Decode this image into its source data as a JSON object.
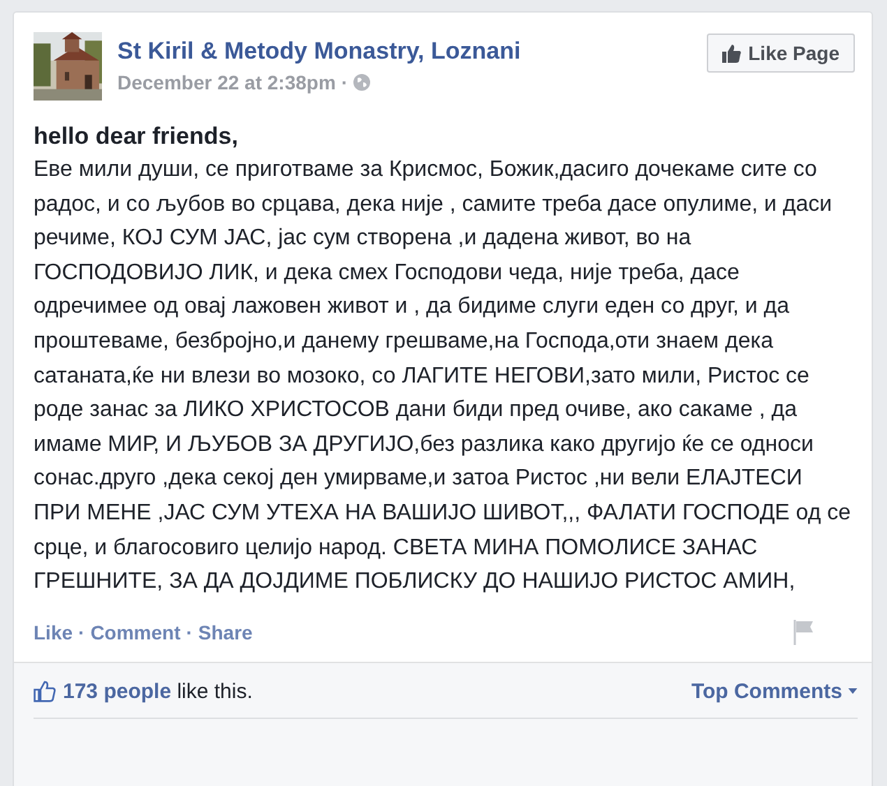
{
  "post": {
    "page_name": "St Kiril & Metody Monastry, Loznani",
    "date": "December 22 at 2:38pm",
    "date_separator": "·",
    "like_page_button": "Like Page",
    "greeting": "hello dear friends,",
    "body": "Еве мили души, се приготваме за Крисмос, Божик,дасиго дочекаме сите со радос, и со љубов во срцава, дека није , самите треба дасе опулиме, и даси речиме, КОЈ СУМ ЈАС, јас сум створена ,и дадена живот, во на ГОСПОДОВИЈО ЛИК, и дека смех Господови чеда, није треба, дасе одречимее од овај лажовен живот и , да бидиме слуги еден со друг, и да проштеваме, безбројно,и данему грешваме,на Господа,оти знаем дека сатаната,ќе ни влези во мозоко, со ЛАГИТЕ НЕГОВИ,зато мили, Ристос се роде занас за ЛИКО ХРИСТОСОВ дани биди пред очиве, ако сакаме , да имаме МИР, И ЉУБОВ ЗА ДРУГИЈО,без разлика како другијо ќе се односи сонас.друго ,дека секој ден умирваме,и затоа Ристос ,ни вели ЕЛАЈТЕСИ ПРИ МЕНЕ ,ЈАС СУМ УТЕХА НА ВАШИЈО ШИВОТ,,, ФАЛАТИ ГОСПОДЕ од се срце, и благосовиго целијо народ. СВЕТА МИНА ПОМОЛИСЕ ЗАНАС ГРЕШНИТЕ, ЗА ДА ДОЈДИМЕ ПОБЛИСКУ ДО НАШИЈО РИСТОС АМИН,",
    "actions": [
      "Like",
      "Comment",
      "Share"
    ],
    "action_separator": "·"
  },
  "footer": {
    "likes_link": "173 people",
    "likes_rest": "like this.",
    "top_comments": "Top Comments"
  }
}
